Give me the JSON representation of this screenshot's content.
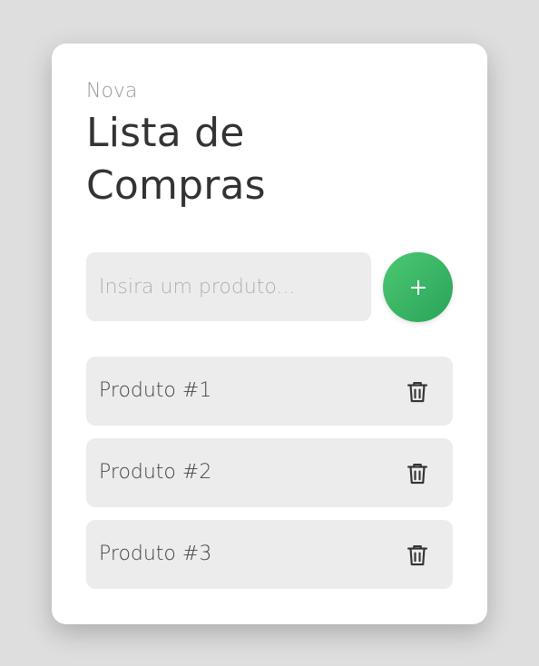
{
  "header": {
    "subtitle": "Nova",
    "title": "Lista de Compras"
  },
  "add_form": {
    "input_placeholder": "Insira um produto...",
    "input_value": "",
    "add_button_icon": "plus-icon",
    "add_button_color": "#3dba68"
  },
  "items": [
    {
      "label": "Produto #1",
      "icon": "trash-icon"
    },
    {
      "label": "Produto #2",
      "icon": "trash-icon"
    },
    {
      "label": "Produto #3",
      "icon": "trash-icon"
    }
  ],
  "colors": {
    "background": "#dedede",
    "card": "#ffffff",
    "item_background": "#ececec",
    "accent": "#3dba68",
    "text": "#333333"
  }
}
